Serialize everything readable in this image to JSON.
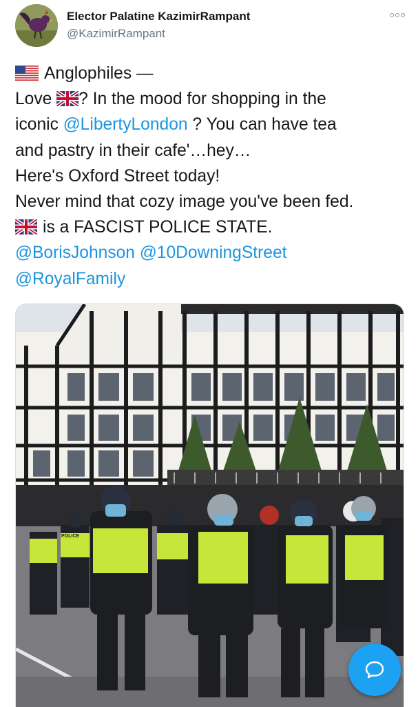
{
  "author": {
    "display_name": "Elector Palatine KazimirRampant",
    "handle": "@KazimirRampant",
    "avatar_icon": "rooster-avatar"
  },
  "tweet": {
    "line1_text": "Anglophiles —",
    "line2_a": "Love ",
    "line2_b": "? In the mood for shopping in the",
    "line3_a": "iconic ",
    "line3_mention": "@LibertyLondon",
    "line3_b": " ? You can have tea",
    "line4": "and pastry in their cafe'…hey…",
    "line5": "Here's Oxford Street today!",
    "line6": "Never mind that cozy image you've been fed.",
    "line7_text": "is a FASCIST POLICE STATE.",
    "mention_boris": "@BorisJohnson",
    "mention_downing": "@10DowningStreet",
    "mention_royal": "@RoyalFamily"
  },
  "media": {
    "description_icon": "photo-police-line-tudor-building",
    "vest_text": "POLICE"
  },
  "icons": {
    "us_flag": "us-flag-icon",
    "uk_flag": "uk-flag-icon",
    "more": "more-options-icon",
    "compose": "compose-reply-icon"
  },
  "colors": {
    "link": "#1b95e0",
    "fab": "#1da1f2",
    "hi_vis": "#c8e63a"
  }
}
